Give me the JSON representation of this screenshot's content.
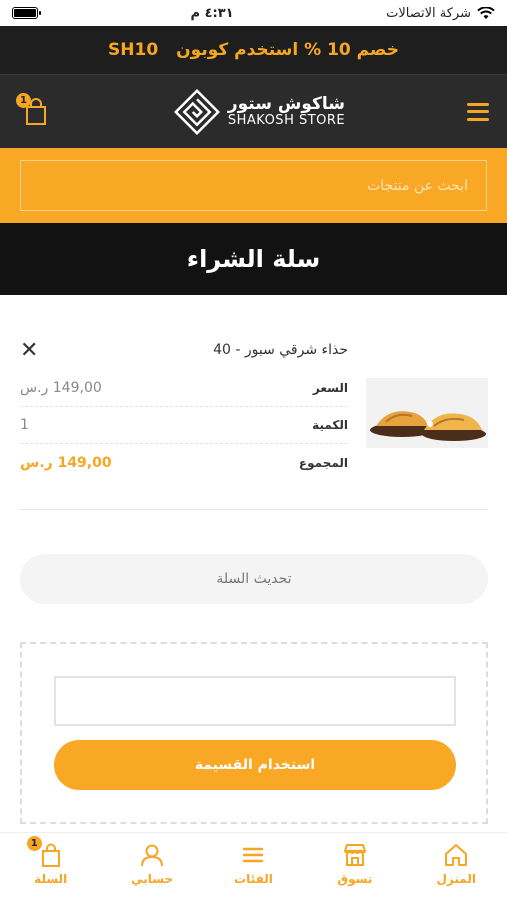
{
  "status_bar": {
    "carrier": "شركة الاتصالات",
    "time": "٤:٣١ م"
  },
  "promo": {
    "text": "خصم 10 % استخدم كوبون",
    "code": "SH10"
  },
  "header": {
    "logo_ar": "شاكوش ستور",
    "logo_en": "SHAKOSH STORE",
    "cart_count": "1"
  },
  "search": {
    "placeholder": "ابحث عن منتجات"
  },
  "page_title": "سلة الشراء",
  "cart_item": {
    "name": "حذاء شرقي سبور - 40",
    "remove_symbol": "✕",
    "price_label": "السعر",
    "price": "149,00 ر.س",
    "qty_label": "الكمية",
    "qty": "1",
    "total_label": "المجموع",
    "total": "149,00 ر.س"
  },
  "update_cart": "تحديث السلة",
  "coupon": {
    "value": "",
    "button": "استخدام القسيمة"
  },
  "tabbar": {
    "cart_count": "1",
    "items": [
      {
        "label": "المنزل",
        "icon": "home-icon"
      },
      {
        "label": "تسوق",
        "icon": "store-icon"
      },
      {
        "label": "الفئات",
        "icon": "menu-icon"
      },
      {
        "label": "حسابي",
        "icon": "user-icon"
      },
      {
        "label": "السلة",
        "icon": "bag-icon"
      }
    ]
  },
  "colors": {
    "accent": "#f9a825",
    "dark": "#121212",
    "header": "#2b2b2b"
  }
}
